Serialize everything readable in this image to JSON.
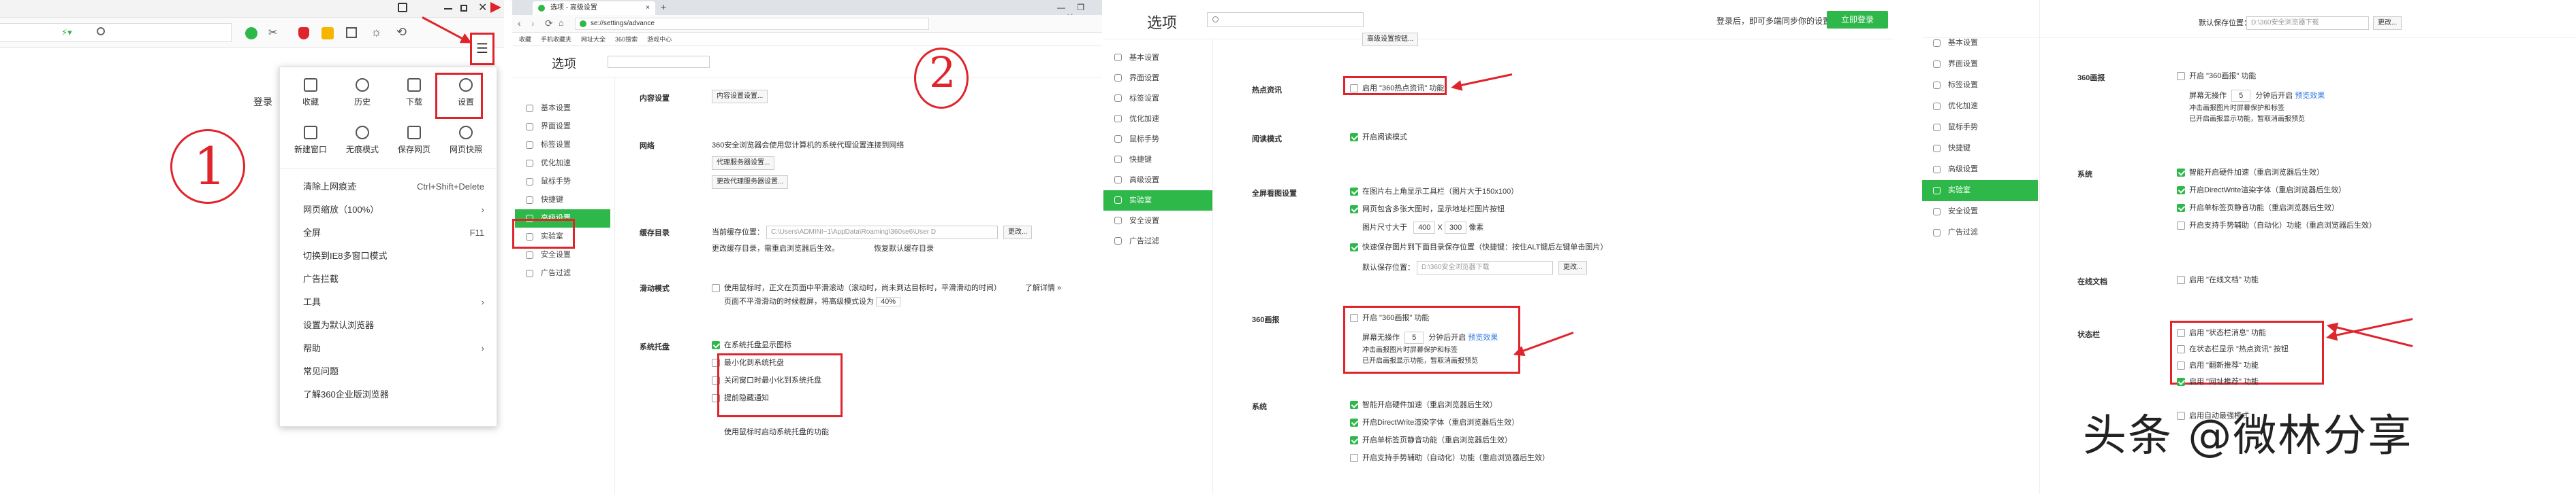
{
  "panel1": {
    "window_controls": [
      "minimize-glyph",
      "restore-glyph",
      "close-glyph"
    ],
    "toolbar": {
      "lightning_glyph": "⚡▾",
      "menu_button_glyph": "☰"
    },
    "login_hint": "登录",
    "annotation_number": "1",
    "quick_items": [
      {
        "label": "收藏",
        "icon": "star-icon"
      },
      {
        "label": "历史",
        "icon": "clock-icon"
      },
      {
        "label": "下载",
        "icon": "download-icon"
      },
      {
        "label": "设置",
        "icon": "gear-icon"
      },
      {
        "label": "新建窗口",
        "icon": "new-window-icon"
      },
      {
        "label": "无痕模式",
        "icon": "incognito-icon"
      },
      {
        "label": "保存网页",
        "icon": "save-page-icon"
      },
      {
        "label": "网页快照",
        "icon": "camera-icon"
      }
    ],
    "menu_items": [
      {
        "label": "清除上网痕迹",
        "shortcut": "Ctrl+Shift+Delete"
      },
      {
        "label": "网页缩放（100%）",
        "shortcut": "›"
      },
      {
        "label": "全屏",
        "shortcut": "F11"
      },
      {
        "label": "切换到IE8多窗口模式",
        "shortcut": ""
      },
      {
        "label": "广告拦截",
        "shortcut": ""
      },
      {
        "label": "工具",
        "shortcut": "›"
      },
      {
        "label": "设置为默认浏览器",
        "shortcut": ""
      },
      {
        "label": "帮助",
        "shortcut": "›"
      },
      {
        "label": "常见问题",
        "shortcut": ""
      },
      {
        "label": "了解360企业版浏览器",
        "shortcut": ""
      }
    ]
  },
  "panel2": {
    "tab_title": "选项 - 高级设置",
    "tab_close": "×",
    "new_tab": "+",
    "address": "se://settings/advance",
    "bookmarks": [
      "收藏",
      "手机收藏夹",
      "网址大全",
      "360搜索",
      "游戏中心"
    ],
    "header_title": "选项",
    "annotation_number": "2",
    "sidebar": [
      "基本设置",
      "界面设置",
      "标签设置",
      "优化加速",
      "鼠标手势",
      "快捷键",
      "高级设置",
      "实验室",
      "安全设置",
      "广告过滤"
    ],
    "active_index": 6,
    "sections": {
      "content": {
        "title": "内容设置",
        "button": "内容设置设置..."
      },
      "network": {
        "title": "网络",
        "desc": "360安全浏览器会使用您计算机的系统代理设置连接到网络",
        "btn1": "代理服务器设置...",
        "btn2": "更改代理服务器设置..."
      },
      "cache": {
        "title": "缓存目录",
        "label": "当前缓存位置：",
        "path": "C:\\Users\\ADMINI~1\\AppData\\Roaming\\360se6\\User D",
        "btn": "更改...",
        "hint": "更改缓存目录，需重启浏览器后生效。",
        "restore": "恢复默认缓存目录"
      },
      "smooth": {
        "title": "滑动模式",
        "opt": "使用鼠标时，正文在页面中平滑滚动（滚动时，尚未到达目标时，平滑滑动的时间）",
        "link": "了解详情 »",
        "sub": "页面不平滑滑动的时候截屏，将高级模式设为",
        "val": "40%"
      },
      "system_tray": {
        "title": "系统托盘",
        "opts": [
          "在系统托盘显示图标",
          "最小化到系统托盘",
          "关闭窗口时最小化到系统托盘",
          "提前隐藏通知"
        ],
        "checked": [
          true,
          false,
          false,
          false
        ],
        "footer": "使用鼠标时启动系统托盘的功能"
      }
    }
  },
  "panel3": {
    "header_title": "选项",
    "search_placeholder": "",
    "login_text": "登录后，即可多端同步你的设置",
    "login_button": "立即登录",
    "top_button": "高级设置按钮...",
    "sidebar": [
      "基本设置",
      "界面设置",
      "标签设置",
      "优化加速",
      "鼠标手势",
      "快捷键",
      "高级设置",
      "实验室",
      "安全设置",
      "广告过滤"
    ],
    "active_index": 7,
    "sections": {
      "hot": {
        "title": "热点资讯",
        "opt": "启用 \"360热点资讯\" 功能"
      },
      "read": {
        "title": "阅读模式",
        "opt": "开启阅读模式"
      },
      "fullimg": {
        "title": "全屏看图设置",
        "opts": [
          "在图片右上角显示工具栏（图片大于150x100）",
          "网页包含多张大图时，显示地址栏图片按钮"
        ],
        "size_label": "图片尺寸大于",
        "w": "400",
        "x": "X",
        "h": "300",
        "px": "像素",
        "opt3": "快速保存图片到下面目录保存位置（快捷键：按住ALT键后左键单击图片）",
        "save_label": "默认保存位置：",
        "save_path": "D:\\360安全浏览器下载",
        "save_btn": "更改..."
      },
      "s360": {
        "title": "360画报",
        "opt": "开启 \"360画报\" 功能",
        "lbl": "屏幕无操作",
        "val": "5",
        "after": "分钟后开启",
        "link": "预览效果",
        "h1": "冲击画报图片时屏幕保护和标签",
        "h2": "已开启画报显示功能，暂取消画报预览"
      },
      "system": {
        "title": "系统",
        "opts": [
          "智能开启硬件加速（重启浏览器后生效）",
          "开启DirectWrite渲染字体（重启浏览器后生效）",
          "开启单标签页静音功能（重启浏览器后生效）",
          "开启支持手势辅助（自动化）功能（重启浏览器后生效）"
        ],
        "checked": [
          true,
          true,
          true,
          false
        ]
      }
    }
  },
  "panel4": {
    "save_label": "默认保存位置：",
    "save_path": "D:\\360安全浏览器下载",
    "save_btn": "更改...",
    "sidebar": [
      "基本设置",
      "界面设置",
      "标签设置",
      "优化加速",
      "鼠标手势",
      "快捷键",
      "高级设置",
      "实验室",
      "安全设置",
      "广告过滤"
    ],
    "active_index": 7,
    "sections": {
      "s360": {
        "title": "360画报",
        "opt": "开启 \"360画报\" 功能",
        "lbl": "屏幕无操作",
        "val": "5",
        "after": "分钟后开启",
        "link": "预览效果",
        "h1": "冲击画报图片时屏幕保护和标签",
        "h2": "已开启画报显示功能，暂取消画报预览"
      },
      "system": {
        "title": "系统",
        "opts": [
          "智能开启硬件加速（重启浏览器后生效）",
          "开启DirectWrite渲染字体（重启浏览器后生效）",
          "开启单标签页静音功能（重启浏览器后生效）",
          "开启支持手势辅助（自动化）功能（重启浏览器后生效）"
        ],
        "checked": [
          true,
          true,
          true,
          false
        ]
      },
      "online": {
        "title": "在线文档",
        "opt": "启用 \"在线文档\" 功能"
      },
      "statusbar": {
        "title": "状态栏",
        "opts": [
          "启用 \"状态栏消息\" 功能",
          "在状态栏显示 \"热点资讯\" 按钮",
          "启用 \"翻新推荐\" 功能",
          "启用 \"网址推荐\" 功能"
        ],
        "checked": [
          false,
          false,
          false,
          true
        ]
      },
      "more": {
        "opt": "启用自动最强模式"
      }
    },
    "watermark": "头条 @微林分享"
  },
  "colors": {
    "accent": "#2fb84a",
    "annotation": "#e0242c",
    "link": "#2b78e4"
  }
}
